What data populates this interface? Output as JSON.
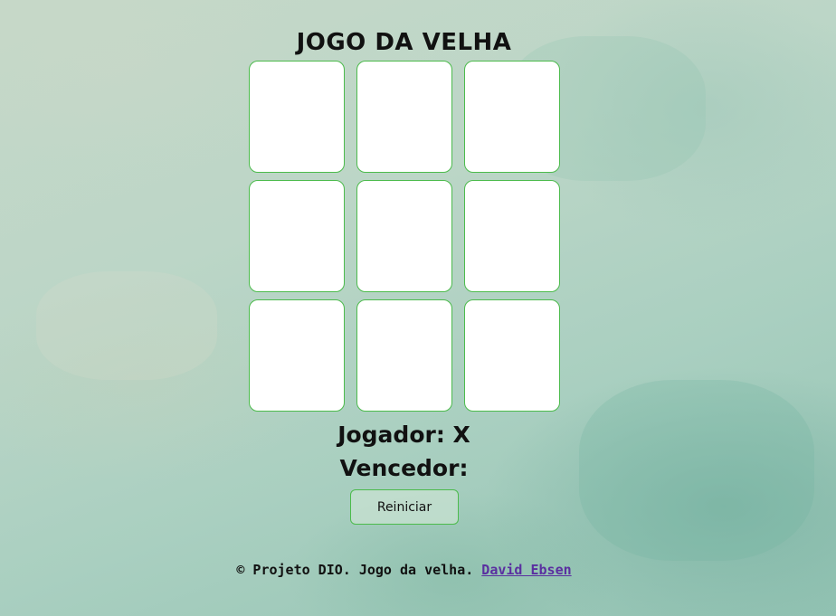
{
  "header": {
    "title": "JOGO DA VELHA"
  },
  "board": {
    "cells": [
      "",
      "",
      "",
      "",
      "",
      "",
      "",
      "",
      ""
    ]
  },
  "status": {
    "player_text": "Jogador: X",
    "winner_text": "Vencedor:"
  },
  "controls": {
    "reset_label": "Reiniciar"
  },
  "footer": {
    "text": "© Projeto DIO. Jogo da velha.",
    "author_link": "David Ebsen"
  },
  "colors": {
    "cell_border": "#4cbb4c",
    "cell_background": "#ffffff",
    "link": "#5a2fa0"
  }
}
